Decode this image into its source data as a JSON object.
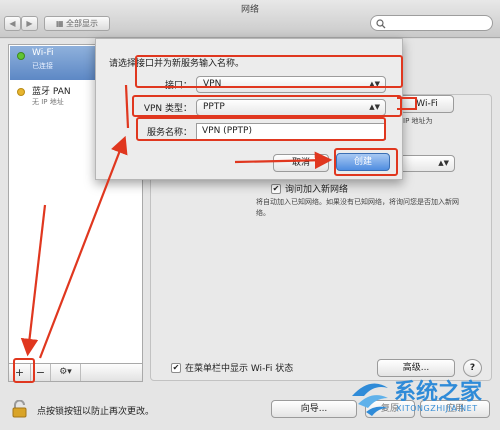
{
  "window": {
    "title": "网络",
    "show_all": "全部显示"
  },
  "services": [
    {
      "name": "Wi-Fi",
      "status": "已连接",
      "color": "#61c534"
    },
    {
      "name": "蓝牙 PAN",
      "status": "无 IP 地址",
      "color": "#e7b52f"
    }
  ],
  "panel": {
    "wifi_button": "Wi-Fi",
    "ip_fragment": "IP 地址为",
    "ask_join_label": "询问加入新网络",
    "ask_join_desc": "将自动加入已知网络。如果没有已知网络，将询问您是否加入新网络。",
    "show_status_label": "在菜单栏中显示 Wi-Fi 状态",
    "advanced_button": "高级...",
    "help": "?",
    "assistant_button": "向导...",
    "revert_button": "复原",
    "apply_button": "应用"
  },
  "sidebar_controls": {
    "add": "+",
    "remove": "−",
    "gear": "⚙▾"
  },
  "lock_text": "点按锁按钮以防止再次更改。",
  "sheet": {
    "prompt": "请选择接口并为新服务输入名称。",
    "interface_label": "接口：",
    "interface_value": "VPN",
    "vpn_type_label": "VPN 类型：",
    "vpn_type_value": "PPTP",
    "service_name_label": "服务名称：",
    "service_name_value": "VPN (PPTP)",
    "cancel_button": "取消",
    "create_button": "创建"
  },
  "watermark": {
    "text": "系统之家",
    "url": "XITONGZHIJIA.NET"
  },
  "colors": {
    "annotation": "#e0371f",
    "selection": "#3d7fd6"
  }
}
